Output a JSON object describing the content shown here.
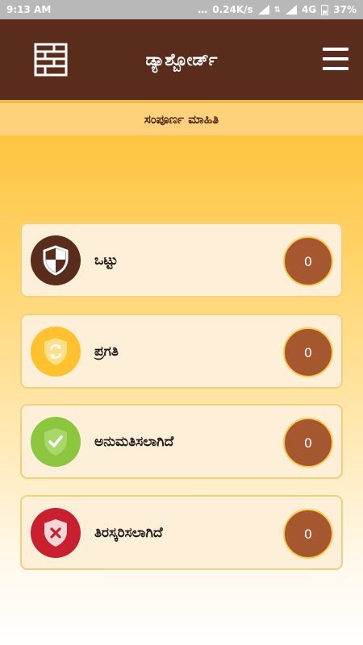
{
  "status_bar": {
    "time": "9:13 AM",
    "network_speed": "0.24K/s",
    "network_type": "4G",
    "battery": "37%"
  },
  "header": {
    "title": "ಡ್ಯಾಶ್ಬೋರ್ಡ್",
    "app_icon": "brick-wall-icon",
    "menu_icon": "hamburger-menu-icon"
  },
  "subtitle": "ಸಂಪೂರ್ಣ ಮಾಹಿತಿ",
  "cards": [
    {
      "label": "ಒಟ್ಟು",
      "count": "0",
      "icon": "shield-icon",
      "color": "#5a2c1c"
    },
    {
      "label": "ಪ್ರಗತಿ",
      "count": "0",
      "icon": "shield-sync-icon",
      "color": "#ffc12e"
    },
    {
      "label": "ಅನುಮತಿಸಲಾಗಿದೆ",
      "count": "0",
      "icon": "shield-check-icon",
      "color": "#8cc63f"
    },
    {
      "label": "ತಿರಸ್ಕರಿಸಲಾಗಿದೆ",
      "count": "0",
      "icon": "shield-x-icon",
      "color": "#c8202f"
    }
  ],
  "colors": {
    "header_bg": "#5a2c1c",
    "count_bg": "#a5572f",
    "card_bg": "#fdefd8"
  }
}
